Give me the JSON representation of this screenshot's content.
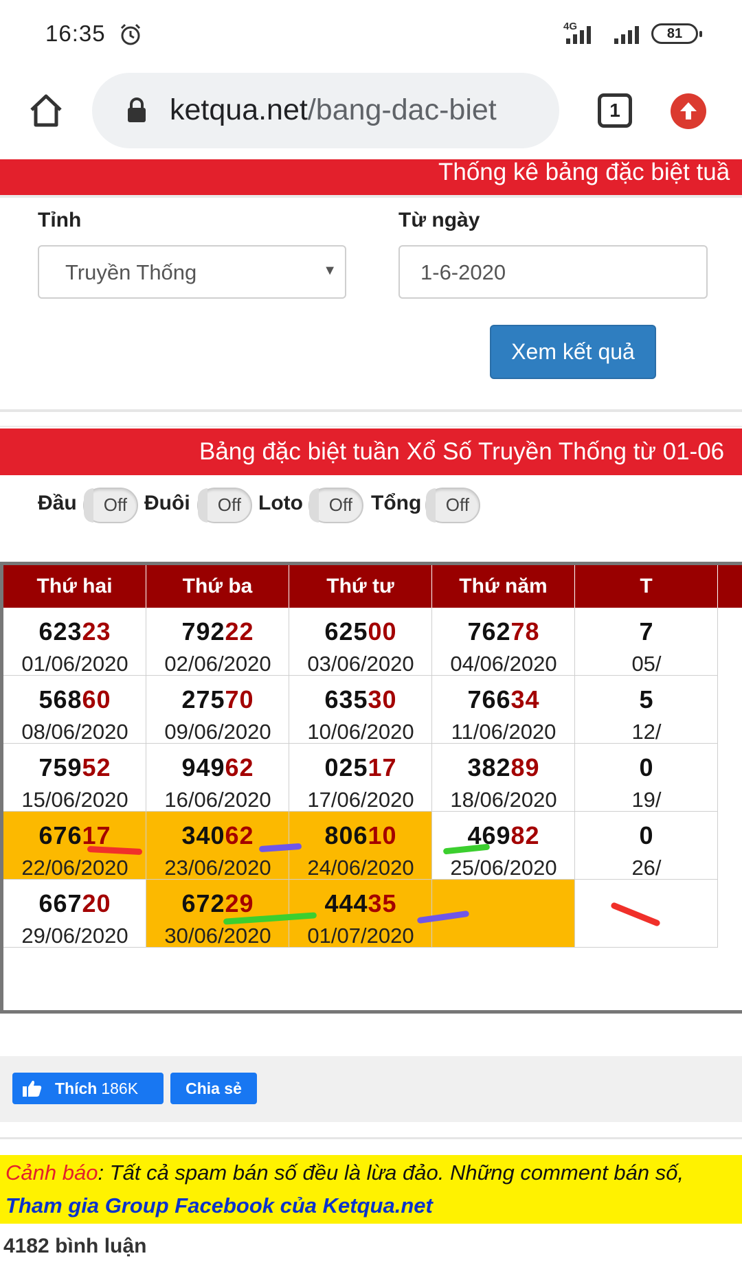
{
  "status_bar": {
    "time": "16:35",
    "network": "4G",
    "battery": "81"
  },
  "browser": {
    "url_domain": "ketqua.net",
    "url_path": "/bang-dac-biet",
    "tab_count": "1"
  },
  "banners": {
    "top": "Thống kê bảng đặc biệt tuầ",
    "table_title": "Bảng đặc biệt tuần Xổ Số Truyền Thống từ 01-06"
  },
  "form": {
    "province_label": "Tỉnh",
    "province_value": "Truyền Thống",
    "from_date_label": "Từ ngày",
    "from_date_value": "1-6-2020",
    "submit_label": "Xem kết quả"
  },
  "toggles": [
    {
      "label": "Đầu",
      "state": "Off"
    },
    {
      "label": "Đuôi",
      "state": "Off"
    },
    {
      "label": "Loto",
      "state": "Off"
    },
    {
      "label": "Tổng",
      "state": "Off"
    }
  ],
  "table": {
    "headers": [
      "Thứ hai",
      "Thứ ba",
      "Thứ tư",
      "Thứ năm",
      "T"
    ],
    "rows": [
      [
        {
          "head": "623",
          "tail": "23",
          "date": "01/06/2020",
          "hl": false
        },
        {
          "head": "792",
          "tail": "22",
          "date": "02/06/2020",
          "hl": false
        },
        {
          "head": "625",
          "tail": "00",
          "date": "03/06/2020",
          "hl": false
        },
        {
          "head": "762",
          "tail": "78",
          "date": "04/06/2020",
          "hl": false
        },
        {
          "head": "7",
          "tail": "",
          "date": "05/",
          "hl": false
        }
      ],
      [
        {
          "head": "568",
          "tail": "60",
          "date": "08/06/2020",
          "hl": false
        },
        {
          "head": "275",
          "tail": "70",
          "date": "09/06/2020",
          "hl": false
        },
        {
          "head": "635",
          "tail": "30",
          "date": "10/06/2020",
          "hl": false
        },
        {
          "head": "766",
          "tail": "34",
          "date": "11/06/2020",
          "hl": false
        },
        {
          "head": "5",
          "tail": "",
          "date": "12/",
          "hl": false
        }
      ],
      [
        {
          "head": "759",
          "tail": "52",
          "date": "15/06/2020",
          "hl": false
        },
        {
          "head": "949",
          "tail": "62",
          "date": "16/06/2020",
          "hl": false
        },
        {
          "head": "025",
          "tail": "17",
          "date": "17/06/2020",
          "hl": false
        },
        {
          "head": "382",
          "tail": "89",
          "date": "18/06/2020",
          "hl": false
        },
        {
          "head": "0",
          "tail": "",
          "date": "19/",
          "hl": false
        }
      ],
      [
        {
          "head": "676",
          "tail": "17",
          "date": "22/06/2020",
          "hl": true
        },
        {
          "head": "340",
          "tail": "62",
          "date": "23/06/2020",
          "hl": true
        },
        {
          "head": "806",
          "tail": "10",
          "date": "24/06/2020",
          "hl": true
        },
        {
          "head": "469",
          "tail": "82",
          "date": "25/06/2020",
          "hl": false
        },
        {
          "head": "0",
          "tail": "",
          "date": "26/",
          "hl": false
        }
      ],
      [
        {
          "head": "667",
          "tail": "20",
          "date": "29/06/2020",
          "hl": false
        },
        {
          "head": "672",
          "tail": "29",
          "date": "30/06/2020",
          "hl": true
        },
        {
          "head": "444",
          "tail": "35",
          "date": "01/07/2020",
          "hl": true
        },
        {
          "head": "",
          "tail": "",
          "date": "",
          "hl": true
        },
        {
          "head": "",
          "tail": "",
          "date": "",
          "hl": false
        }
      ]
    ]
  },
  "annotations": {
    "colors": {
      "red": "#f0302a",
      "purple": "#6f56e8",
      "green": "#3ccf2f"
    }
  },
  "share": {
    "like_label": "Thích",
    "like_count": "186K",
    "share_label": "Chia sẻ"
  },
  "warning": {
    "prefix": "Cảnh báo",
    "text": ": Tất cả spam bán số đều là lừa đảo. Những comment bán số,",
    "group_link": "Tham gia Group Facebook của Ketqua.net"
  },
  "comments": {
    "count_text": "4182 bình luận"
  }
}
